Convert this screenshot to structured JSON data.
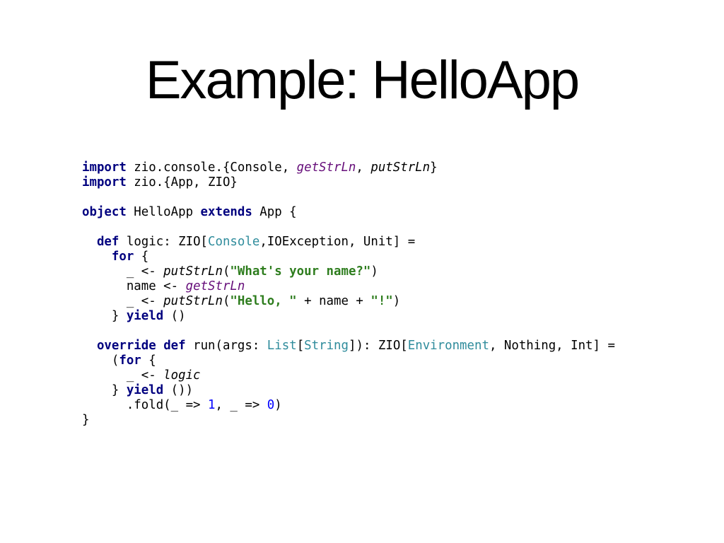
{
  "slide": {
    "title": "Example: HelloApp"
  },
  "colors": {
    "keyword": "#00007f",
    "method_purple": "#660e7a",
    "type": "#2f8c9c",
    "string": "#2e7d1e",
    "number": "#0000ff",
    "text": "#000000",
    "background": "#ffffff"
  },
  "code": {
    "language": "scala",
    "lines": [
      [
        {
          "t": "import",
          "c": "kw"
        },
        {
          "t": " zio.console.{Console, "
        },
        {
          "t": "getStrLn",
          "c": "fn-purple"
        },
        {
          "t": ", "
        },
        {
          "t": "putStrLn",
          "c": "fn-italic"
        },
        {
          "t": "}"
        }
      ],
      [
        {
          "t": "import",
          "c": "kw"
        },
        {
          "t": " zio.{App, ZIO}"
        }
      ],
      [],
      [
        {
          "t": "object",
          "c": "kw"
        },
        {
          "t": " HelloApp "
        },
        {
          "t": "extends",
          "c": "kw"
        },
        {
          "t": " App {"
        }
      ],
      [],
      [
        {
          "t": "  "
        },
        {
          "t": "def",
          "c": "kw"
        },
        {
          "t": " logic: ZIO["
        },
        {
          "t": "Console",
          "c": "type"
        },
        {
          "t": ",IOException, Unit] ="
        }
      ],
      [
        {
          "t": "    "
        },
        {
          "t": "for",
          "c": "kw"
        },
        {
          "t": " {"
        }
      ],
      [
        {
          "t": "      _ <- "
        },
        {
          "t": "putStrLn",
          "c": "fn-italic"
        },
        {
          "t": "("
        },
        {
          "t": "\"What's your name?\"",
          "c": "str"
        },
        {
          "t": ")"
        }
      ],
      [
        {
          "t": "      name <- "
        },
        {
          "t": "getStrLn",
          "c": "fn-purple"
        }
      ],
      [
        {
          "t": "      _ <- "
        },
        {
          "t": "putStrLn",
          "c": "fn-italic"
        },
        {
          "t": "("
        },
        {
          "t": "\"Hello, \"",
          "c": "str"
        },
        {
          "t": " + name + "
        },
        {
          "t": "\"!\"",
          "c": "str"
        },
        {
          "t": ")"
        }
      ],
      [
        {
          "t": "    } "
        },
        {
          "t": "yield",
          "c": "kw"
        },
        {
          "t": " ()"
        }
      ],
      [],
      [
        {
          "t": "  "
        },
        {
          "t": "override",
          "c": "kw"
        },
        {
          "t": " "
        },
        {
          "t": "def",
          "c": "kw"
        },
        {
          "t": " run(args: "
        },
        {
          "t": "List",
          "c": "type"
        },
        {
          "t": "["
        },
        {
          "t": "String",
          "c": "type"
        },
        {
          "t": "]): ZIO["
        },
        {
          "t": "Environment",
          "c": "type"
        },
        {
          "t": ", Nothing, Int] ="
        }
      ],
      [
        {
          "t": "    ("
        },
        {
          "t": "for",
          "c": "kw"
        },
        {
          "t": " {"
        }
      ],
      [
        {
          "t": "      _ <- "
        },
        {
          "t": "logic",
          "c": "fn-italic"
        }
      ],
      [
        {
          "t": "    } "
        },
        {
          "t": "yield",
          "c": "kw"
        },
        {
          "t": " ())"
        }
      ],
      [
        {
          "t": "      .fold(_ => "
        },
        {
          "t": "1",
          "c": "num"
        },
        {
          "t": ", _ => "
        },
        {
          "t": "0",
          "c": "num"
        },
        {
          "t": ")"
        }
      ],
      [
        {
          "t": "}"
        }
      ]
    ]
  }
}
